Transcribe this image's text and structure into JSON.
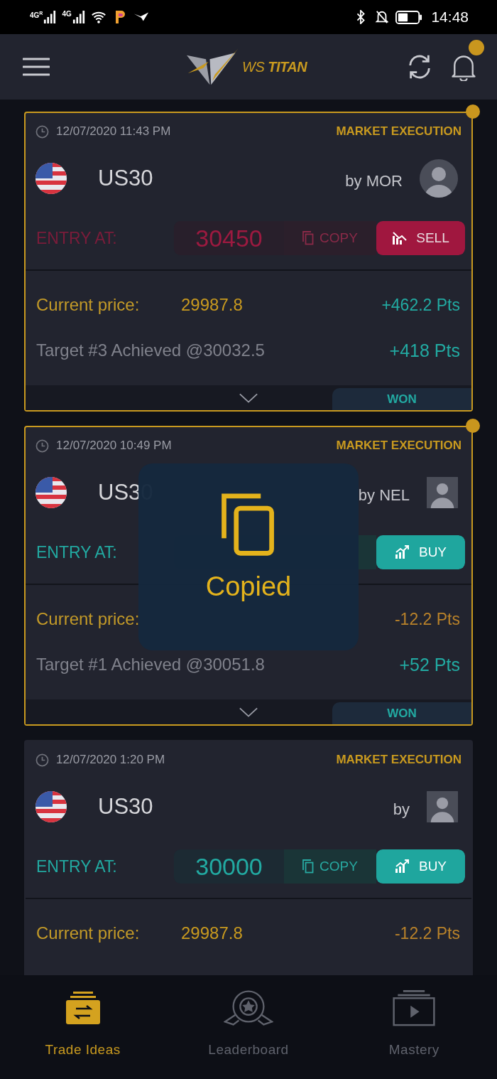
{
  "status_bar": {
    "networks": [
      "4G$^{R}$",
      "4G"
    ],
    "time": "14:48"
  },
  "header": {
    "brand": "WS **TITAN**",
    "notification_badge": true
  },
  "cards": [
    {
      "kind": "sell",
      "highlighted": true,
      "timestamp": "12/07/2020 11:43 PM",
      "execution": "MARKET EXECUTION",
      "symbol": "US30",
      "author": "by MOR",
      "avatar": {
        "kind": "circle"
      },
      "entry_label": "ENTRY AT:",
      "entry_value": "30450",
      "copy_label": "COPY",
      "action_label": "SELL",
      "current_label": "Current price:",
      "current_value": "29987.8",
      "points": {
        "text": "+462.2 Pts",
        "color": "#22aaa2"
      },
      "target": "Target #3 Achieved @30032.5",
      "target_points": "+418 Pts",
      "status": "WON"
    },
    {
      "kind": "buy",
      "highlighted": true,
      "timestamp": "12/07/2020 10:49 PM",
      "execution": "MARKET EXECUTION",
      "symbol": "US30",
      "author": "by NEL",
      "avatar": {
        "kind": "square"
      },
      "entry_label": "ENTRY AT:",
      "action_label": "BUY",
      "current_label": "Current price:",
      "points": {
        "text": "-12.2 Pts",
        "color": "#b9822a"
      },
      "target": "Target #1 Achieved @30051.8",
      "target_points": "+52 Pts",
      "status": "WON"
    },
    {
      "kind": "buy",
      "highlighted": false,
      "timestamp": "12/07/2020 1:20 PM",
      "execution": "MARKET EXECUTION",
      "symbol": "US30",
      "author": "by",
      "avatar": {
        "kind": "square"
      },
      "entry_label": "ENTRY AT:",
      "entry_value": "30000",
      "copy_label": "COPY",
      "action_label": "BUY",
      "current_label": "Current price:",
      "current_value": "29987.8",
      "points": {
        "text": "-12.2 Pts",
        "color": "#b9822a"
      }
    }
  ],
  "toast": {
    "text": "Copied"
  },
  "bottom_nav": [
    {
      "kind": "trade",
      "label": "Trade Ideas",
      "selected": true
    },
    {
      "kind": "award",
      "label": "Leaderboard",
      "selected": false
    },
    {
      "kind": "video",
      "label": "Mastery",
      "selected": false
    }
  ]
}
